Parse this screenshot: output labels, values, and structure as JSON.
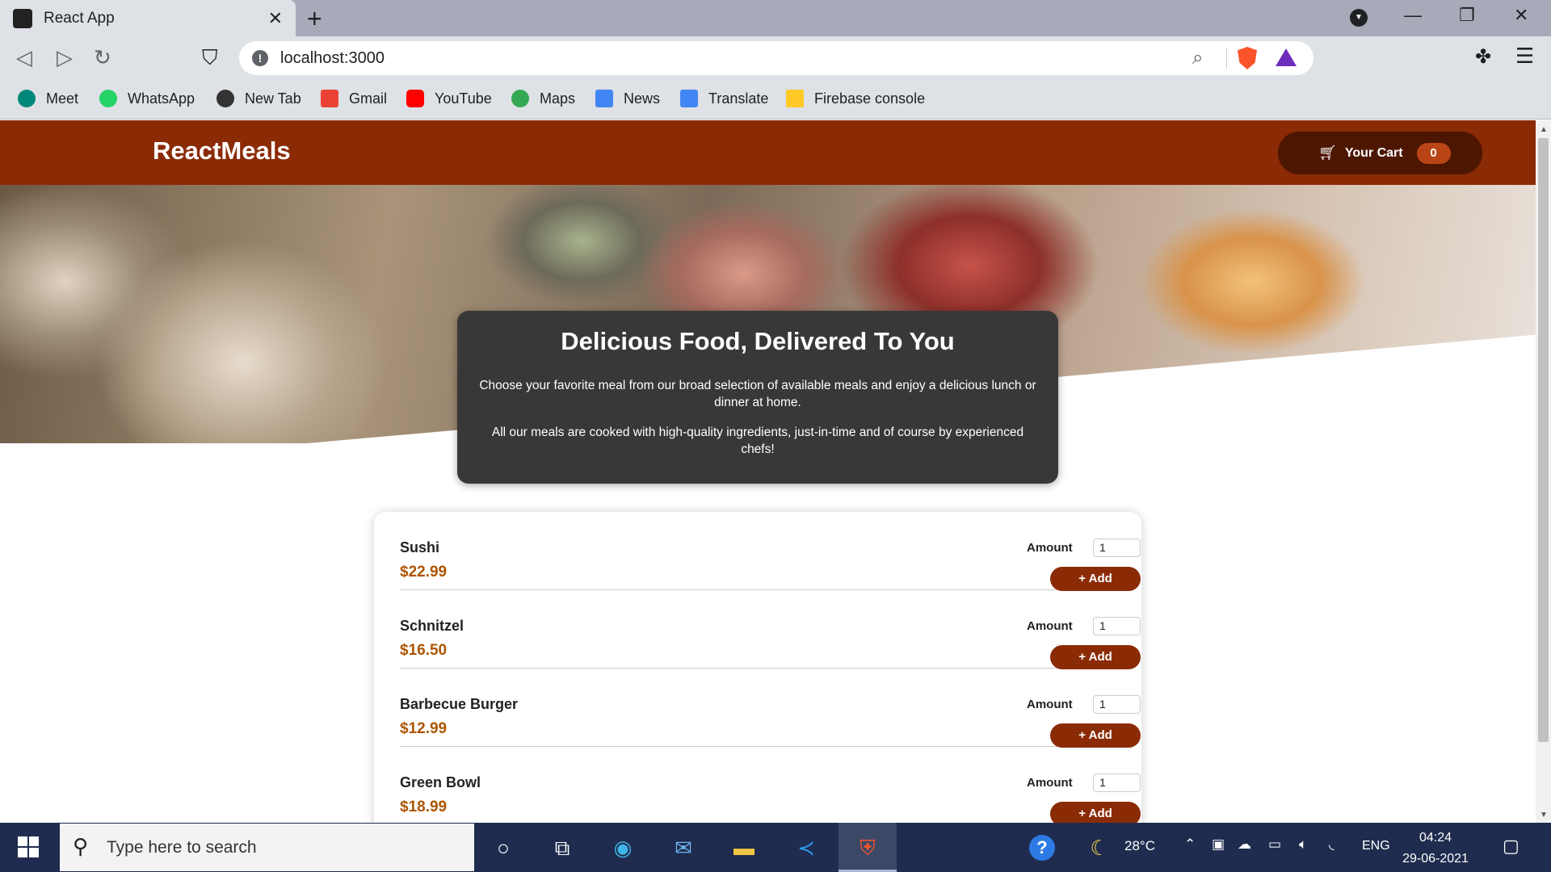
{
  "browser": {
    "tab_title": "React App",
    "url": "localhost:3000",
    "bookmarks": [
      "Meet",
      "WhatsApp",
      "New Tab",
      "Gmail",
      "YouTube",
      "Maps",
      "News",
      "Translate",
      "Firebase console"
    ]
  },
  "header": {
    "brand": "ReactMeals",
    "cart_label": "Your Cart",
    "cart_count": "0"
  },
  "summary": {
    "title": "Delicious Food, Delivered To You",
    "p1": "Choose your favorite meal from our broad selection of available meals and enjoy a delicious lunch or dinner at home.",
    "p2": "All our meals are cooked with high-quality ingredients, just-in-time and of course by experienced chefs!"
  },
  "meals": [
    {
      "name": "Sushi",
      "price": "$22.99",
      "amount_label": "Amount",
      "amount": "1",
      "add_label": "+ Add"
    },
    {
      "name": "Schnitzel",
      "price": "$16.50",
      "amount_label": "Amount",
      "amount": "1",
      "add_label": "+ Add"
    },
    {
      "name": "Barbecue Burger",
      "price": "$12.99",
      "amount_label": "Amount",
      "amount": "1",
      "add_label": "+ Add"
    },
    {
      "name": "Green Bowl",
      "price": "$18.99",
      "amount_label": "Amount",
      "amount": "1",
      "add_label": "+ Add"
    }
  ],
  "taskbar": {
    "search_placeholder": "Type here to search",
    "weather": "28°C",
    "language": "ENG",
    "time": "04:24",
    "date": "29-06-2021"
  },
  "colors": {
    "header": "#8a2b06",
    "cart_button": "#4d1601",
    "badge": "#b94517",
    "price": "#ad5502",
    "summary_bg": "#383838"
  },
  "icons": {
    "cart": "cart-icon",
    "search": "search-icon",
    "start": "windows-start-icon"
  }
}
